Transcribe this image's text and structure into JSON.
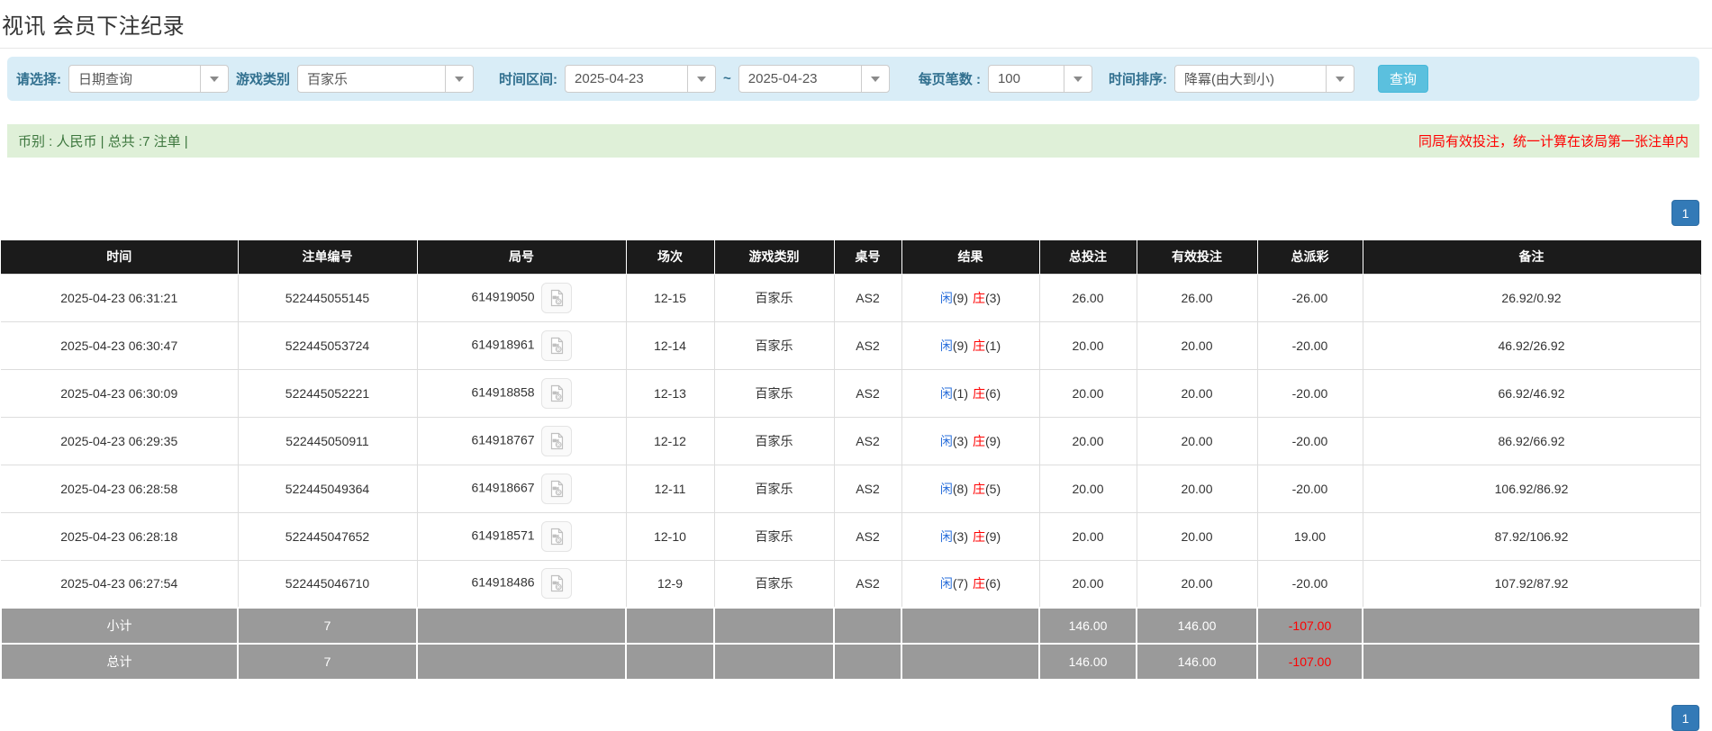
{
  "page": {
    "title": "视讯 会员下注纪录"
  },
  "filters": {
    "mode": {
      "label": "请选择:",
      "value": "日期查询"
    },
    "game_type": {
      "label": "游戏类别",
      "value": "百家乐"
    },
    "date_range": {
      "label": "时间区间:",
      "from": "2025-04-23",
      "separator": "~",
      "to": "2025-04-23"
    },
    "page_size": {
      "label": "每页笔数 :",
      "value": "100"
    },
    "time_sort": {
      "label": "时间排序:",
      "value": "降冪(由大到小)"
    },
    "search_label": "查询"
  },
  "notice": {
    "left": "币别 : 人民币 | 总共 :7 注单 |",
    "right": "同局有效投注，统一计算在该局第一张注单内"
  },
  "pagination": {
    "page": "1"
  },
  "table": {
    "headers": [
      "时间",
      "注单编号",
      "局号",
      "场次",
      "游戏类别",
      "桌号",
      "结果",
      "总投注",
      "有效投注",
      "总派彩",
      "备注"
    ],
    "rows": [
      {
        "time": "2025-04-23 06:31:21",
        "bet_id": "522445055145",
        "round_id": "614919050",
        "session": "12-15",
        "game": "百家乐",
        "table_code": "AS2",
        "result": {
          "player": "闲",
          "player_score": "(9)",
          "banker": "庄",
          "banker_score": "(3)"
        },
        "total_bet": "26.00",
        "valid_bet": "26.00",
        "payout": "-26.00",
        "remark": "26.92/0.92"
      },
      {
        "time": "2025-04-23 06:30:47",
        "bet_id": "522445053724",
        "round_id": "614918961",
        "session": "12-14",
        "game": "百家乐",
        "table_code": "AS2",
        "result": {
          "player": "闲",
          "player_score": "(9)",
          "banker": "庄",
          "banker_score": "(1)"
        },
        "total_bet": "20.00",
        "valid_bet": "20.00",
        "payout": "-20.00",
        "remark": "46.92/26.92"
      },
      {
        "time": "2025-04-23 06:30:09",
        "bet_id": "522445052221",
        "round_id": "614918858",
        "session": "12-13",
        "game": "百家乐",
        "table_code": "AS2",
        "result": {
          "player": "闲",
          "player_score": "(1)",
          "banker": "庄",
          "banker_score": "(6)"
        },
        "total_bet": "20.00",
        "valid_bet": "20.00",
        "payout": "-20.00",
        "remark": "66.92/46.92"
      },
      {
        "time": "2025-04-23 06:29:35",
        "bet_id": "522445050911",
        "round_id": "614918767",
        "session": "12-12",
        "game": "百家乐",
        "table_code": "AS2",
        "result": {
          "player": "闲",
          "player_score": "(3)",
          "banker": "庄",
          "banker_score": "(9)"
        },
        "total_bet": "20.00",
        "valid_bet": "20.00",
        "payout": "-20.00",
        "remark": "86.92/66.92"
      },
      {
        "time": "2025-04-23 06:28:58",
        "bet_id": "522445049364",
        "round_id": "614918667",
        "session": "12-11",
        "game": "百家乐",
        "table_code": "AS2",
        "result": {
          "player": "闲",
          "player_score": "(8)",
          "banker": "庄",
          "banker_score": "(5)"
        },
        "total_bet": "20.00",
        "valid_bet": "20.00",
        "payout": "-20.00",
        "remark": "106.92/86.92"
      },
      {
        "time": "2025-04-23 06:28:18",
        "bet_id": "522445047652",
        "round_id": "614918571",
        "session": "12-10",
        "game": "百家乐",
        "table_code": "AS2",
        "result": {
          "player": "闲",
          "player_score": "(3)",
          "banker": "庄",
          "banker_score": "(9)"
        },
        "total_bet": "20.00",
        "valid_bet": "20.00",
        "payout": "19.00",
        "remark": "87.92/106.92"
      },
      {
        "time": "2025-04-23 06:27:54",
        "bet_id": "522445046710",
        "round_id": "614918486",
        "session": "12-9",
        "game": "百家乐",
        "table_code": "AS2",
        "result": {
          "player": "闲",
          "player_score": "(7)",
          "banker": "庄",
          "banker_score": "(6)"
        },
        "total_bet": "20.00",
        "valid_bet": "20.00",
        "payout": "-20.00",
        "remark": "107.92/87.92"
      }
    ],
    "summary": [
      {
        "label": "小计",
        "count": "7",
        "total_bet": "146.00",
        "valid_bet": "146.00",
        "payout": "-107.00"
      },
      {
        "label": "总计",
        "count": "7",
        "total_bet": "146.00",
        "valid_bet": "146.00",
        "payout": "-107.00"
      }
    ]
  },
  "colors": {
    "accent_blue": "#337ab7",
    "link_blue": "#2a6fdb",
    "negative_red": "#ff0000",
    "highlight_yellow": "#f7f673",
    "header_black": "#1b1b1b",
    "summary_gray": "#9a9a9a",
    "filter_bg": "#d9edf7",
    "notice_bg": "#dff0d8"
  }
}
